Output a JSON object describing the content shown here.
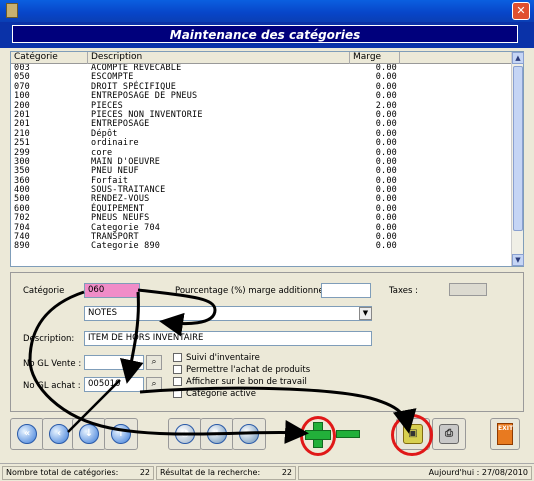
{
  "window": {
    "close_glyph": "✕"
  },
  "header": {
    "title": "Maintenance des catégories"
  },
  "grid": {
    "columns": [
      "Catégorie",
      "Description",
      "Marge"
    ],
    "rows": [
      {
        "code": "003",
        "desc": "ACOMPTE REVECABLE",
        "margin": "0.00"
      },
      {
        "code": "050",
        "desc": "ESCOMPTE",
        "margin": "0.00"
      },
      {
        "code": "070",
        "desc": "DROIT SPÉCIFIQUE",
        "margin": "0.00"
      },
      {
        "code": "100",
        "desc": "ENTREPOSAGE DE PNEUS",
        "margin": "0.00"
      },
      {
        "code": "200",
        "desc": "PIECES",
        "margin": "2.00"
      },
      {
        "code": "201",
        "desc": "PIECES NON INVENTORIE",
        "margin": "0.00"
      },
      {
        "code": "201",
        "desc": "ENTREPOSAGE",
        "margin": "0.00"
      },
      {
        "code": "210",
        "desc": "Dépôt",
        "margin": "0.00"
      },
      {
        "code": "251",
        "desc": "ordinaire",
        "margin": "0.00"
      },
      {
        "code": "299",
        "desc": "core",
        "margin": "0.00"
      },
      {
        "code": "300",
        "desc": "MAIN D'OEUVRE",
        "margin": "0.00"
      },
      {
        "code": "350",
        "desc": "PNEU NEUF",
        "margin": "0.00"
      },
      {
        "code": "360",
        "desc": "Forfait",
        "margin": "0.00"
      },
      {
        "code": "400",
        "desc": "SOUS-TRAITANCE",
        "margin": "0.00"
      },
      {
        "code": "500",
        "desc": "RENDEZ-VOUS",
        "margin": "0.00"
      },
      {
        "code": "600",
        "desc": "ÉQUIPEMENT",
        "margin": "0.00"
      },
      {
        "code": "702",
        "desc": "PNEUS NEUFS",
        "margin": "0.00"
      },
      {
        "code": "704",
        "desc": "Categorie 704",
        "margin": "0.00"
      },
      {
        "code": "740",
        "desc": "TRANSPORT",
        "margin": "0.00"
      },
      {
        "code": "890",
        "desc": "Categorie 890",
        "margin": "0.00"
      }
    ]
  },
  "form": {
    "categorie_label": "Catégorie",
    "categorie_value": "060",
    "pct_label": "Pourcentage (%) marge additionnelle :",
    "pct_value": "",
    "taxes_label": "Taxes :",
    "type_value": "NOTES",
    "description_label": "Description:",
    "description_value": "ITEM DE HORS INVENTAIRE",
    "gl_vente_label": "No GL Vente :",
    "gl_vente_value": "",
    "gl_achat_label": "No GL achat :",
    "gl_achat_value": "005010",
    "check_suivi": "Suivi d'inventaire",
    "check_permettre": "Permettre l'achat de produits",
    "check_afficher": "Afficher sur le bon de travail",
    "check_categorie": "Catégorie active"
  },
  "toolbar": {
    "exit_label": "EXIT"
  },
  "status": {
    "total_label": "Nombre total de catégories:",
    "total_value": "22",
    "result_label": "Résultat de la recherche:",
    "result_value": "22",
    "date_text": "Aujourd'hui : 27/08/2010"
  },
  "colors": {
    "accent": "#0a32a8",
    "highlight": "#f08cc8",
    "annotation": "#e01818"
  }
}
